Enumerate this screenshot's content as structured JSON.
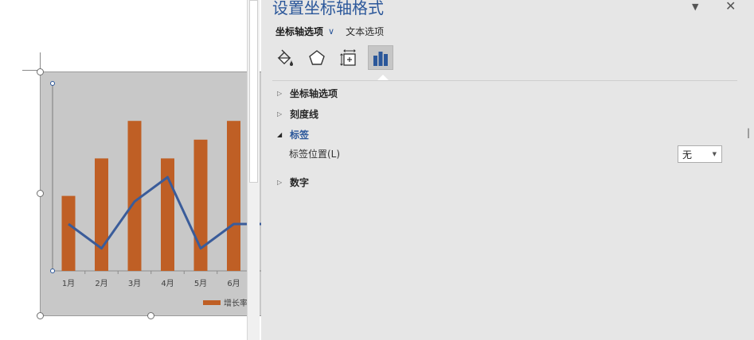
{
  "chart": {
    "chart_data": {
      "type": "bar",
      "categories": [
        "1月",
        "2月",
        "3月",
        "4月",
        "5月",
        "6月"
      ],
      "series": [
        {
          "name": "增长率",
          "type": "bar",
          "values": [
            40,
            60,
            80,
            60,
            70,
            80
          ]
        },
        {
          "type": "line",
          "values": [
            25,
            12,
            37,
            50,
            12,
            25
          ]
        }
      ],
      "ylim": [
        0,
        100
      ],
      "grid": false,
      "legend": "bottom-right"
    },
    "legend_text": "增长率",
    "colors": {
      "bar": "#bf5f25",
      "line": "#3a5c9a",
      "plot_bg": "#c8c8c8"
    }
  },
  "pane": {
    "title": "设置坐标轴格式",
    "dropdown_icon": "chevron-down-icon",
    "close_label": "✕",
    "tabs": [
      {
        "label": "坐标轴选项",
        "active": true
      },
      {
        "label": "文本选项",
        "active": false
      }
    ],
    "icons": [
      "fill-line-icon",
      "effects-pentagon-icon",
      "size-properties-icon",
      "axis-options-bar-icon"
    ],
    "sections": [
      {
        "label": "坐标轴选项",
        "expanded": false
      },
      {
        "label": "刻度线",
        "expanded": false
      },
      {
        "label": "标签",
        "expanded": true
      },
      {
        "label": "数字",
        "expanded": false
      }
    ],
    "label_position": {
      "label": "标签位置(L)",
      "value": "无"
    },
    "accent": "#2b579a"
  }
}
